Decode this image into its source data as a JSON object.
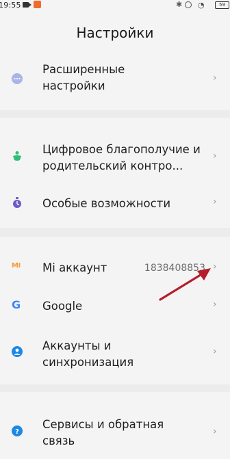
{
  "status_bar": {
    "time": "19:55",
    "battery": "59"
  },
  "page": {
    "title": "Настройки"
  },
  "rows": {
    "advanced": {
      "label": "Расширенные настройки"
    },
    "digital_wellbeing": {
      "label": "Цифровое благополучие и родительский контро..."
    },
    "accessibility": {
      "label": "Особые возможности"
    },
    "mi_account": {
      "label": "Mi аккаунт",
      "value": "1838408853",
      "logo": "MI"
    },
    "google": {
      "label": "Google",
      "logo": "G"
    },
    "accounts_sync": {
      "label": "Аккаунты и синхронизация"
    },
    "services_feedback": {
      "label": "Сервисы и обратная связь"
    }
  },
  "icons": {
    "advanced": "more-dots-icon",
    "digital_wellbeing": "digital-wellbeing-icon",
    "accessibility": "accessibility-icon",
    "mi_account": "mi-logo-icon",
    "google": "google-g-icon",
    "accounts_sync": "person-icon",
    "services_feedback": "help-icon",
    "chevron": "chevron-right-icon"
  },
  "colors": {
    "advanced": "#a9b5e8",
    "digital_wellbeing": "#2fbf7a",
    "accessibility": "#6a5cc9",
    "mi": "#f39c34",
    "account_blue": "#1e88e5",
    "annotation_arrow": "#b51d2e"
  },
  "chevron_glyph": "›"
}
